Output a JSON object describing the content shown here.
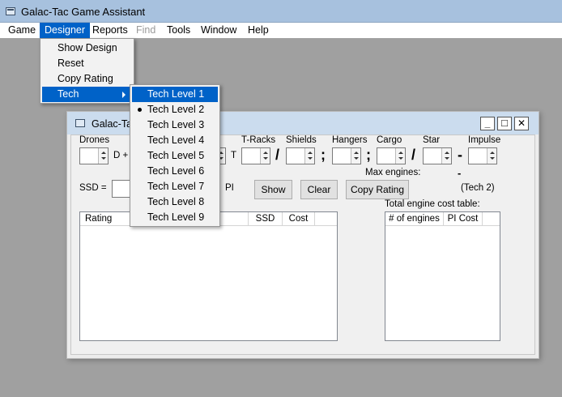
{
  "app": {
    "title": "Galac-Tac Game Assistant"
  },
  "menubar": {
    "items": [
      {
        "label": "Game"
      },
      {
        "label": "Designer"
      },
      {
        "label": "Reports"
      },
      {
        "label": "Find"
      },
      {
        "label": "Tools"
      },
      {
        "label": "Window"
      },
      {
        "label": "Help"
      }
    ],
    "active": "Designer",
    "disabled": [
      "Find"
    ]
  },
  "designer_menu": {
    "items": [
      {
        "label": "Show Design"
      },
      {
        "label": "Reset"
      },
      {
        "label": "Copy Rating"
      },
      {
        "label": "Tech",
        "has_submenu": true
      }
    ],
    "selected": "Tech"
  },
  "tech_submenu": {
    "items": [
      {
        "label": "Tech Level 1"
      },
      {
        "label": "Tech Level 2"
      },
      {
        "label": "Tech Level 3"
      },
      {
        "label": "Tech Level 4"
      },
      {
        "label": "Tech Level 5"
      },
      {
        "label": "Tech Level 6"
      },
      {
        "label": "Tech Level 7"
      },
      {
        "label": "Tech Level 8"
      },
      {
        "label": "Tech Level 9"
      }
    ],
    "highlighted": "Tech Level 1",
    "checked": "Tech Level 2"
  },
  "child_window": {
    "title": "Galac-Tac",
    "buttons": {
      "minimize": "_",
      "maximize": "□",
      "close": "✕"
    },
    "labels": {
      "drones": "Drones",
      "d_plus": "D +",
      "tubes_suffix": "es",
      "t_racks": "T-Racks",
      "shields": "Shields",
      "hangers": "Hangers",
      "cargo": "Cargo",
      "star": "Star",
      "impulse": "Impulse",
      "t": "T",
      "slash1": "/",
      "semi1": ";",
      "semi2": ";",
      "slash2": "/",
      "dash": "-",
      "max_engines": "Max engines:",
      "max_engines_value": "-",
      "ssd": "SSD =",
      "pi": "PI",
      "tech": "(Tech 2)",
      "engine_cost_table": "Total engine cost table:"
    },
    "actions": {
      "show": "Show",
      "clear": "Clear",
      "copy_rating": "Copy Rating"
    },
    "rating_table": {
      "columns": [
        "Rating",
        "SSD",
        "Cost"
      ]
    },
    "engine_table": {
      "columns": [
        "# of engines",
        "PI Cost"
      ]
    }
  }
}
